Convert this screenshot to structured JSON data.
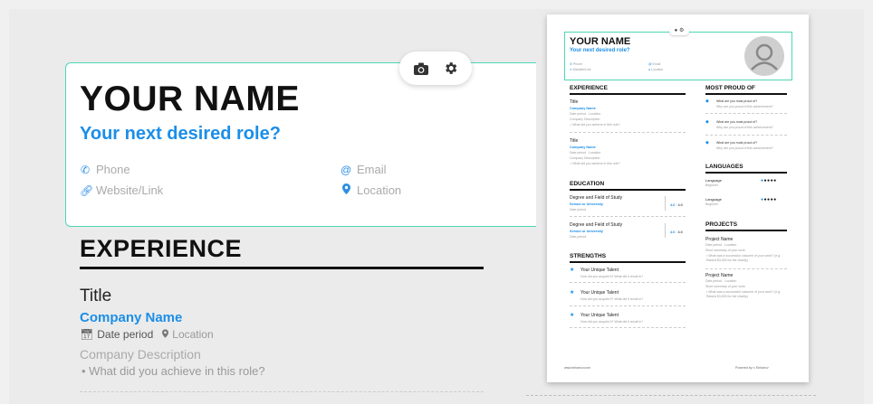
{
  "header": {
    "name": "YOUR NAME",
    "role": "Your next desired role?",
    "phone": "Phone",
    "email": "Email",
    "website": "Website/Link",
    "location": "Location"
  },
  "experience": {
    "section": "EXPERIENCE",
    "title": "Title",
    "company": "Company Name",
    "date": "Date period",
    "location": "Location",
    "description": "Company Description",
    "bullet": "What did you achieve in this role?"
  },
  "mini": {
    "name": "YOUR NAME",
    "role": "Your next desired role?",
    "phone": "Phone",
    "email": "Email",
    "website": "Website/Link",
    "location": "Location",
    "experience": "EXPERIENCE",
    "exp_items": [
      {
        "title": "Title",
        "company": "Company Name",
        "date": "Date period",
        "loc": "Location",
        "desc": "Company Description",
        "bullet": "What did you achieve in this role?"
      },
      {
        "title": "Title",
        "company": "Company Name",
        "date": "Date period",
        "loc": "Location",
        "desc": "Company Description",
        "bullet": "What did you achieve in this role?"
      }
    ],
    "education": "EDUCATION",
    "edu_items": [
      {
        "degree": "Degree and Field of Study",
        "school": "School or University",
        "date": "Date period",
        "gpa": "4.0",
        "gpa_max": "4.0"
      },
      {
        "degree": "Degree and Field of Study",
        "school": "School or University",
        "date": "Date period",
        "gpa": "4.0",
        "gpa_max": "4.0"
      }
    ],
    "strengths": "STRENGTHS",
    "strength_items": [
      {
        "name": "Your Unique Talent",
        "desc": "How did you acquire it? What did it result in?"
      },
      {
        "name": "Your Unique Talent",
        "desc": "How did you acquire it? What did it result in?"
      },
      {
        "name": "Your Unique Talent",
        "desc": "How did you acquire it? What did it result in?"
      }
    ],
    "proud": "MOST PROUD OF",
    "proud_items": [
      {
        "q": "What are you most proud of?",
        "a": "Why are you proud of this achievement?"
      },
      {
        "q": "What are you most proud of?",
        "a": "Why are you proud of this achievement?"
      },
      {
        "q": "What are you most proud of?",
        "a": "Why are you proud of this achievement?"
      }
    ],
    "languages": "LANGUAGES",
    "lang_items": [
      {
        "name": "Language",
        "level": "Beginner"
      },
      {
        "name": "Language",
        "level": "Beginner"
      }
    ],
    "projects": "PROJECTS",
    "project_items": [
      {
        "name": "Project Name",
        "date": "Date period",
        "loc": "Location",
        "summary": "Short summary of your work",
        "bullet": "What was a successful outcome of your work? (e.g. Raised $3,000 for the charity)"
      },
      {
        "name": "Project Name",
        "date": "Date period",
        "loc": "Location",
        "summary": "Short summary of your work",
        "bullet": "What was a successful outcome of your work? (e.g. Raised $3,000 for the charity)"
      }
    ],
    "footer_left": "www.enhancv.com",
    "footer_powered": "Powered by",
    "footer_brand": "Enhancv"
  },
  "colors": {
    "accent": "#1b8ee8",
    "border": "#4dd6b5"
  },
  "icons": [
    "camera-icon",
    "gear-icon",
    "phone-icon",
    "at-icon",
    "link-icon",
    "location-pin-icon",
    "calendar-icon",
    "star-icon",
    "diamond-icon",
    "avatar-icon"
  ]
}
